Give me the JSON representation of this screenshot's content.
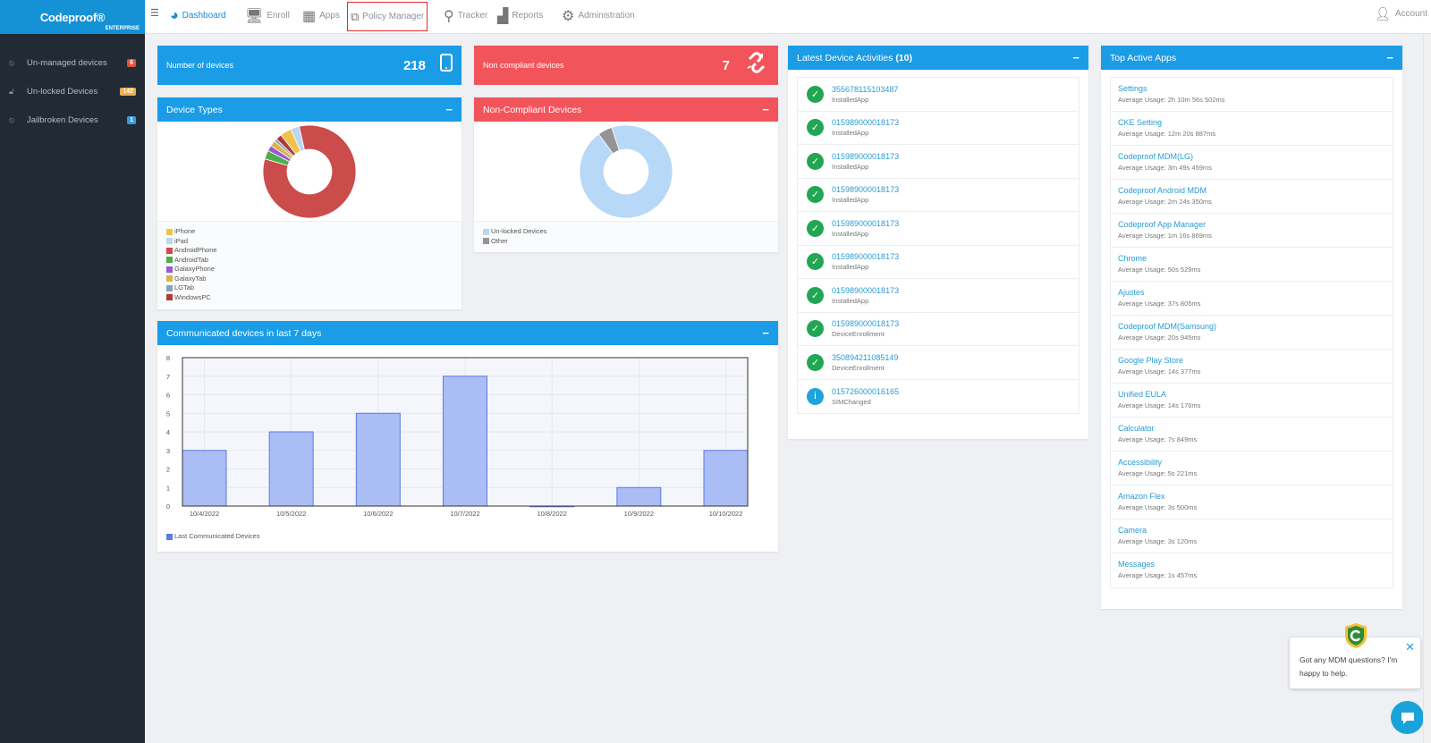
{
  "brand": {
    "name": "Codeproof®",
    "edition": "ENTERPRISE"
  },
  "sidebar": {
    "items": [
      {
        "label": "Un-managed devices",
        "badge": "6",
        "badge_color": "#e74c3c"
      },
      {
        "label": "Un-locked Devices",
        "badge": "142",
        "badge_color": "#f0ad4e"
      },
      {
        "label": "Jailbroken Devices",
        "badge": "1",
        "badge_color": "#3a9ad9"
      }
    ]
  },
  "nav": {
    "menu_icon": "hamburger-icon",
    "items": [
      {
        "label": "Dashboard",
        "icon": "dashboard-gauge-icon"
      },
      {
        "label": "Enroll",
        "icon": "enroll-devices-icon"
      },
      {
        "label": "Apps",
        "icon": "apps-grid-icon"
      },
      {
        "label": "Policy Manager",
        "icon": "policy-tree-icon"
      },
      {
        "label": "Tracker",
        "icon": "map-pin-icon"
      },
      {
        "label": "Reports",
        "icon": "bar-chart-icon"
      },
      {
        "label": "Administration",
        "icon": "gear-icon"
      }
    ],
    "account": "Account"
  },
  "stats": {
    "devices": {
      "label": "Number of devices",
      "value": "218",
      "color": "#1a9ce6"
    },
    "noncompliant": {
      "label": "Non compliant devices",
      "value": "7",
      "color": "#f2545b"
    }
  },
  "device_types": {
    "title": "Device Types",
    "chart_data": {
      "type": "pie",
      "labels": [
        "iPhone",
        "iPad",
        "AndroidPhone",
        "AndroidTab",
        "GalaxyPhone",
        "GalaxyTab",
        "LGTab",
        "WindowsPC"
      ],
      "values": [
        4,
        3,
        83,
        3,
        2,
        2,
        1,
        2
      ],
      "colors": [
        "#f0c24a",
        "#b7d8f2",
        "#cc4b4b",
        "#4cae4c",
        "#9b59d6",
        "#d9b44a",
        "#8aa2b6",
        "#b03a3a"
      ]
    }
  },
  "noncompliant_devices": {
    "title": "Non-Compliant Devices",
    "chart_data": {
      "type": "pie",
      "labels": [
        "Un-locked Devices",
        "Other"
      ],
      "values": [
        95,
        5
      ],
      "colors": [
        "#b7d8f7",
        "#949494"
      ]
    }
  },
  "communicated": {
    "title": "Communicated devices in last 7 days",
    "chart_data": {
      "type": "bar",
      "categories": [
        "10/4/2022",
        "10/5/2022",
        "10/6/2022",
        "10/7/2022",
        "10/8/2022",
        "10/9/2022",
        "10/10/2022"
      ],
      "series": [
        {
          "name": "Last Communicated Devices",
          "values": [
            3,
            4,
            5,
            7,
            0,
            1,
            3
          ]
        }
      ],
      "ylim": [
        0,
        8
      ],
      "yticks": [
        "0",
        "1",
        "2",
        "3",
        "4",
        "5",
        "6",
        "7",
        "8"
      ],
      "grid": true,
      "bar_color": "#aabdf5",
      "bar_edge": "#5b7be6"
    }
  },
  "activities": {
    "title": "Latest Device Activities",
    "count": "(10)",
    "items": [
      {
        "id": "355678115103487",
        "type": "InstalledApp",
        "icon": "check-circle-icon"
      },
      {
        "id": "015989000018173",
        "type": "InstalledApp",
        "icon": "check-circle-icon"
      },
      {
        "id": "015989000018173",
        "type": "InstalledApp",
        "icon": "check-circle-icon"
      },
      {
        "id": "015989000018173",
        "type": "InstalledApp",
        "icon": "check-circle-icon"
      },
      {
        "id": "015989000018173",
        "type": "InstalledApp",
        "icon": "check-circle-icon"
      },
      {
        "id": "015989000018173",
        "type": "InstalledApp",
        "icon": "check-circle-icon"
      },
      {
        "id": "015989000018173",
        "type": "InstalledApp",
        "icon": "check-circle-icon"
      },
      {
        "id": "015989000018173",
        "type": "DeviceEnrollment",
        "icon": "check-circle-icon"
      },
      {
        "id": "350894211085149",
        "type": "DeviceEnrollment",
        "icon": "check-circle-icon"
      },
      {
        "id": "015726000016165",
        "type": "SIMChanged",
        "icon": "info-circle-icon"
      }
    ]
  },
  "top_apps": {
    "title": "Top Active Apps",
    "items": [
      {
        "name": "Settings",
        "usage": "Average Usage: 2h 10m 56s 502ms"
      },
      {
        "name": "CKE Setting",
        "usage": "Average Usage: 12m 20s 887ms"
      },
      {
        "name": "Codeproof MDM(LG)",
        "usage": "Average Usage: 3m 49s 459ms"
      },
      {
        "name": "Codeproof Android MDM",
        "usage": "Average Usage: 2m 24s 350ms"
      },
      {
        "name": "Codeproof App Manager",
        "usage": "Average Usage: 1m 16s 869ms"
      },
      {
        "name": "Chrome",
        "usage": "Average Usage: 50s 529ms"
      },
      {
        "name": "Ajustes",
        "usage": "Average Usage: 37s 805ms"
      },
      {
        "name": "Codeproof MDM(Samsung)",
        "usage": "Average Usage: 20s 945ms"
      },
      {
        "name": "Google Play Store",
        "usage": "Average Usage: 14s 377ms"
      },
      {
        "name": "Unified EULA",
        "usage": "Average Usage: 14s 176ms"
      },
      {
        "name": "Calculator",
        "usage": "Average Usage: 7s 849ms"
      },
      {
        "name": "Accessibility",
        "usage": "Average Usage: 5s 221ms"
      },
      {
        "name": "Amazon Flex",
        "usage": "Average Usage: 3s 500ms"
      },
      {
        "name": "Camera",
        "usage": "Average Usage: 3s 120ms"
      },
      {
        "name": "Messages",
        "usage": "Average Usage: 1s 457ms"
      }
    ]
  },
  "chat": {
    "message": "Got any MDM questions? I'm happy to help."
  }
}
